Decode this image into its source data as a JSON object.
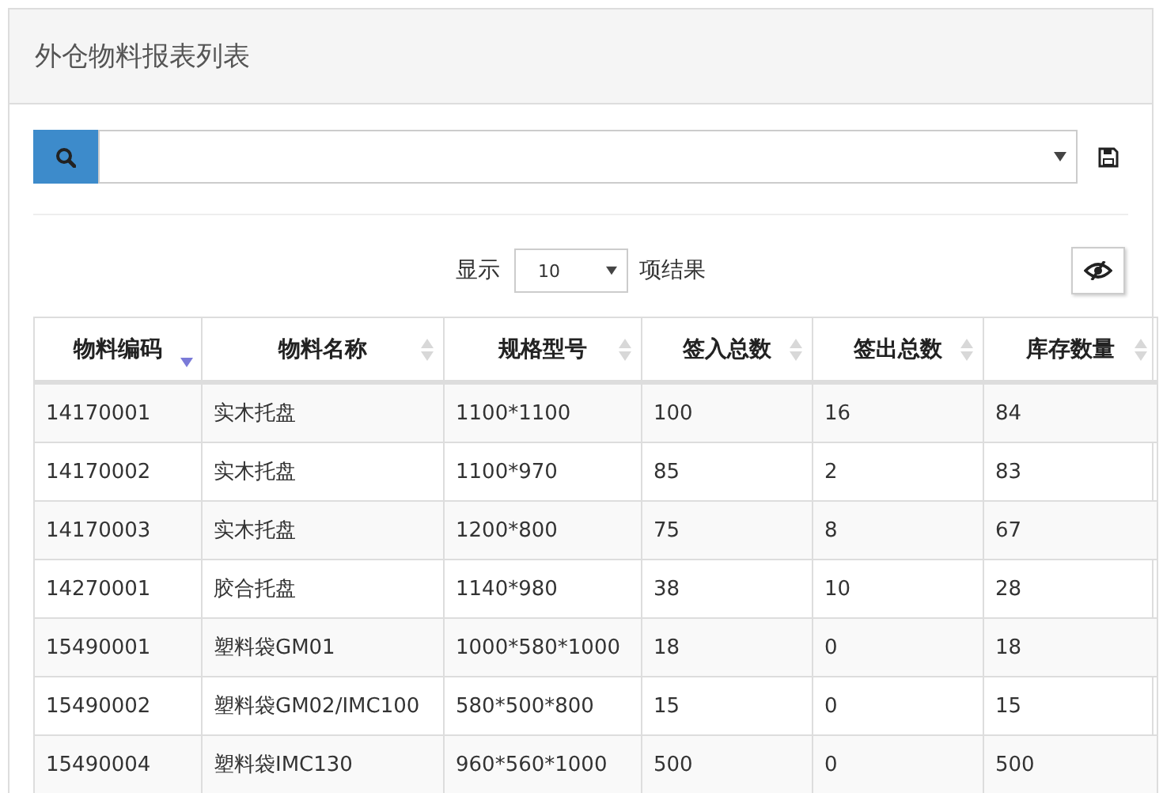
{
  "panel": {
    "title": "外仓物料报表列表"
  },
  "length_menu": {
    "prefix": "显示",
    "value": "10",
    "suffix": "项结果"
  },
  "table": {
    "columns": [
      {
        "label": "物料编码",
        "sorted": true
      },
      {
        "label": "物料名称",
        "sorted": false
      },
      {
        "label": "规格型号",
        "sorted": false
      },
      {
        "label": "签入总数",
        "sorted": false
      },
      {
        "label": "签出总数",
        "sorted": false
      },
      {
        "label": "库存数量",
        "sorted": false
      }
    ],
    "rows": [
      [
        "14170001",
        "实木托盘",
        "1100*1100",
        "100",
        "16",
        "84"
      ],
      [
        "14170002",
        "实木托盘",
        "1100*970",
        "85",
        "2",
        "83"
      ],
      [
        "14170003",
        "实木托盘",
        "1200*800",
        "75",
        "8",
        "67"
      ],
      [
        "14270001",
        "胶合托盘",
        "1140*980",
        "38",
        "10",
        "28"
      ],
      [
        "15490001",
        "塑料袋GM01",
        "1000*580*1000",
        "18",
        "0",
        "18"
      ],
      [
        "15490002",
        "塑料袋GM02/IMC100",
        "580*500*800",
        "15",
        "0",
        "15"
      ],
      [
        "15490004",
        "塑料袋IMC130",
        "960*560*1000",
        "500",
        "0",
        "500"
      ]
    ]
  }
}
